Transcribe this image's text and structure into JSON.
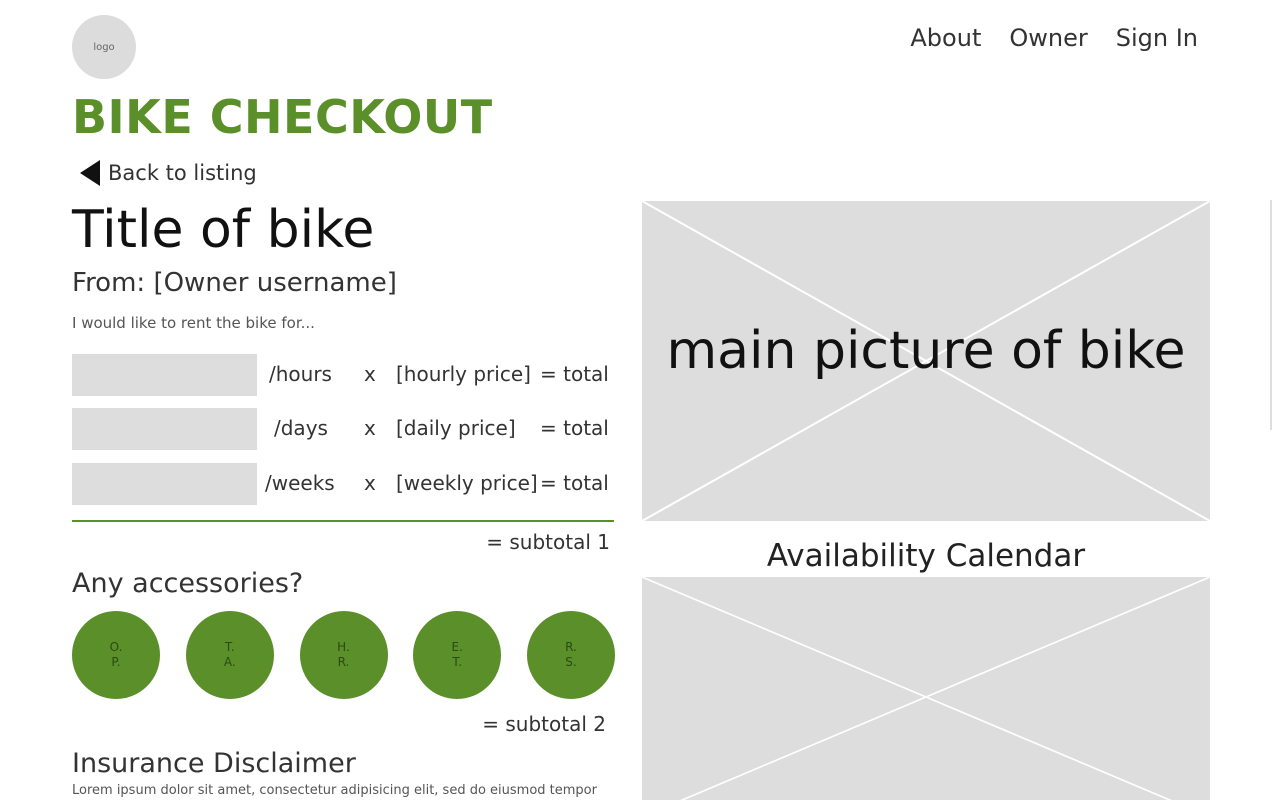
{
  "header": {
    "logo_text": "logo",
    "nav": [
      {
        "label": "About"
      },
      {
        "label": "Owner"
      },
      {
        "label": "Sign In"
      }
    ],
    "brand": "BIKE CHECKOUT"
  },
  "back_link": {
    "label": "Back to listing",
    "icon": "caret-left-icon"
  },
  "bike": {
    "title": "Title of bike",
    "from": "From: [Owner username]",
    "prompt": "I would like to rent the bike for..."
  },
  "rates": [
    {
      "unit": "/hours",
      "times": "x",
      "price": "[hourly price]",
      "total": "= total"
    },
    {
      "unit": "/days",
      "times": "x",
      "price": "[daily price]",
      "total": "= total"
    },
    {
      "unit": "/weeks",
      "times": "x",
      "price": "[weekly price]",
      "total": "= total"
    }
  ],
  "subtotal1": "= subtotal 1",
  "accessories": {
    "title": "Any accessories?",
    "items": [
      {
        "label": "O.\nP."
      },
      {
        "label": "T.\nA."
      },
      {
        "label": "H.\nR."
      },
      {
        "label": "E.\nT."
      },
      {
        "label": "R.\nS."
      }
    ]
  },
  "subtotal2": "= subtotal 2",
  "insurance": {
    "title": "Insurance Disclaimer",
    "body": "Lorem ipsum dolor sit amet, consectetur adipisicing elit, sed do eiusmod tempor"
  },
  "main_picture": {
    "caption": "main picture of bike"
  },
  "availability": {
    "title": "Availability Calendar"
  },
  "colors": {
    "accent": "#5a8f29",
    "placeholder": "#dddddd",
    "logo_bg": "#dcdcdc"
  }
}
